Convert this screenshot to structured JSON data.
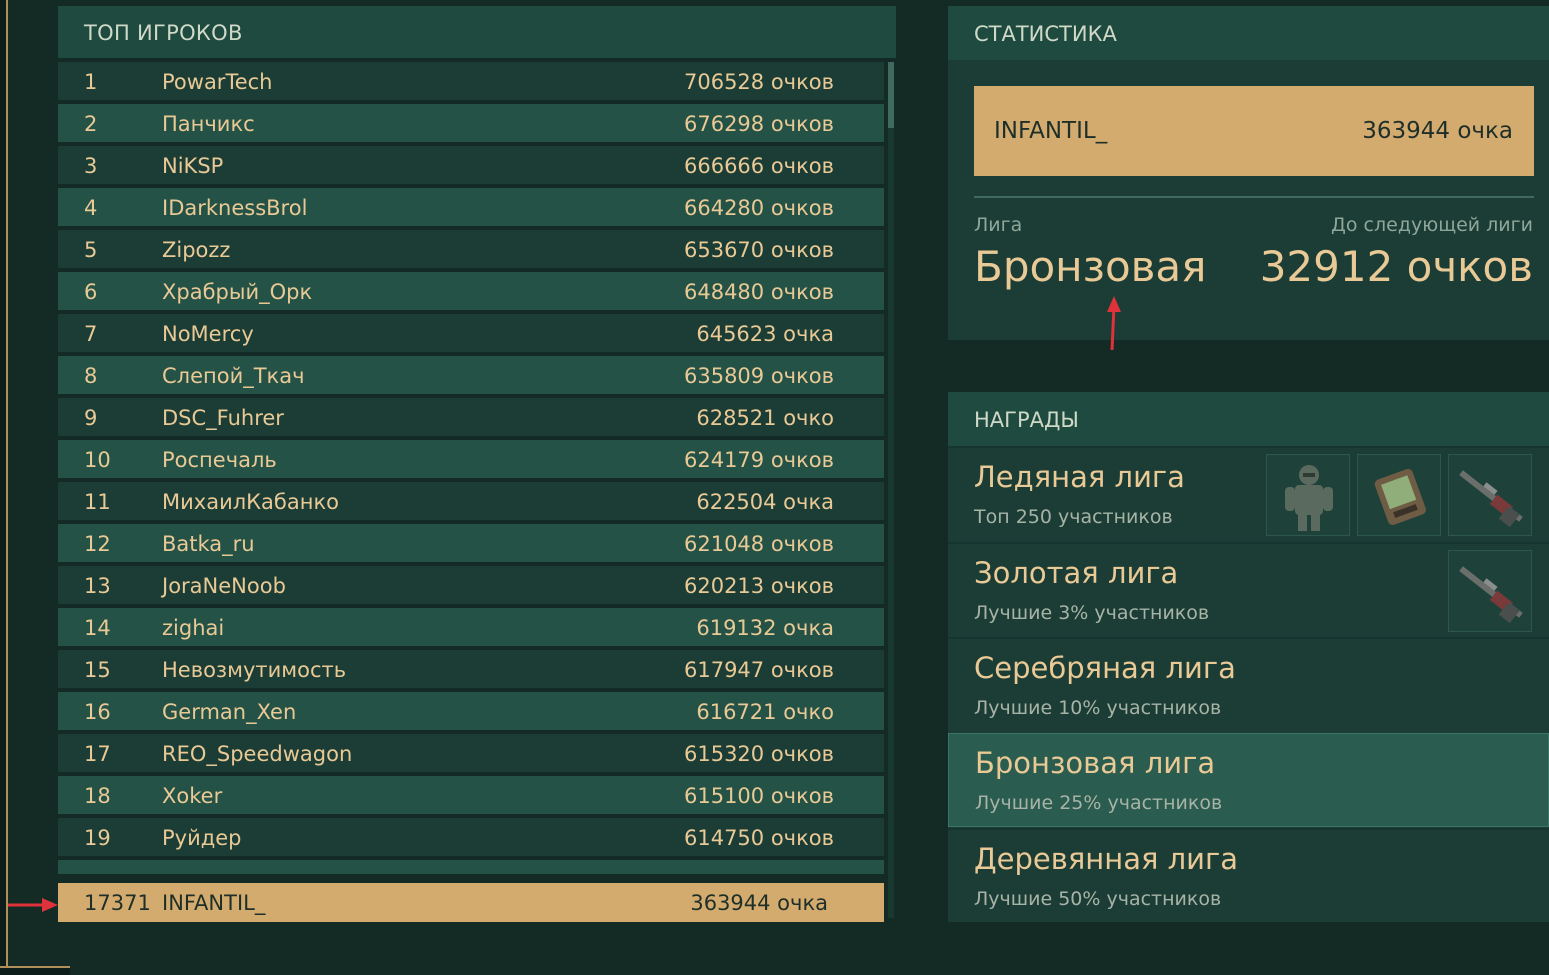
{
  "top_players": {
    "header": "ТОП ИГРОКОВ",
    "rows": [
      {
        "rank": "1",
        "name": "PowarTech",
        "points": "706528 очков"
      },
      {
        "rank": "2",
        "name": "Панчикс",
        "points": "676298 очков"
      },
      {
        "rank": "3",
        "name": "NiKSP",
        "points": "666666 очков"
      },
      {
        "rank": "4",
        "name": "IDarknessBrol",
        "points": "664280 очков"
      },
      {
        "rank": "5",
        "name": "Zipozz",
        "points": "653670 очков"
      },
      {
        "rank": "6",
        "name": "Храбрый_Орк",
        "points": "648480 очков"
      },
      {
        "rank": "7",
        "name": "NoMercy",
        "points": "645623 очка"
      },
      {
        "rank": "8",
        "name": "Слепой_Ткач",
        "points": "635809 очков"
      },
      {
        "rank": "9",
        "name": "DSC_Fuhrer",
        "points": "628521 очко"
      },
      {
        "rank": "10",
        "name": "Роспечаль",
        "points": "624179 очков"
      },
      {
        "rank": "11",
        "name": "МихаилКабанко",
        "points": "622504 очка"
      },
      {
        "rank": "12",
        "name": "Batka_ru",
        "points": "621048 очков"
      },
      {
        "rank": "13",
        "name": "JoraNeNoob",
        "points": "620213 очков"
      },
      {
        "rank": "14",
        "name": "zighai",
        "points": "619132 очка"
      },
      {
        "rank": "15",
        "name": "Невозмутимость",
        "points": "617947 очков"
      },
      {
        "rank": "16",
        "name": "German_Xen",
        "points": "616721 очко"
      },
      {
        "rank": "17",
        "name": "REO_Speedwagon",
        "points": "615320 очков"
      },
      {
        "rank": "18",
        "name": "Xoker",
        "points": "615100 очков"
      },
      {
        "rank": "19",
        "name": "Руйдер",
        "points": "614750 очков"
      }
    ],
    "my_row": {
      "rank": "17371",
      "name": "INFANTIL_",
      "points": "363944 очка"
    }
  },
  "stats": {
    "header": "СТАТИСТИКА",
    "player_name": "INFANTIL_",
    "player_points": "363944 очка",
    "league_label": "Лига",
    "league_value": "Бронзовая",
    "next_label": "До следующей лиги",
    "next_value": "32912 очков"
  },
  "rewards": {
    "header": "НАГРАДЫ",
    "leagues": [
      {
        "title": "Ледяная лига",
        "subtitle": "Топ 250 участников",
        "items": [
          "armor-icon",
          "device-icon",
          "rifle-icon"
        ]
      },
      {
        "title": "Золотая лига",
        "subtitle": "Лучшие 3% участников",
        "items": [
          "rifle-icon"
        ]
      },
      {
        "title": "Серебряная лига",
        "subtitle": "Лучшие 10% участников",
        "items": []
      },
      {
        "title": "Бронзовая лига",
        "subtitle": "Лучшие 25% участников",
        "items": [],
        "active": true
      },
      {
        "title": "Деревянная лига",
        "subtitle": "Лучшие 50% участников",
        "items": []
      }
    ]
  },
  "colors": {
    "background": "#132a25",
    "header": "#1f4a3f",
    "row_odd": "#1b3d35",
    "row_even": "#245246",
    "highlight": "#d4ab6e",
    "text_gold": "#e9c995",
    "annotation_arrow": "#e0323a"
  }
}
